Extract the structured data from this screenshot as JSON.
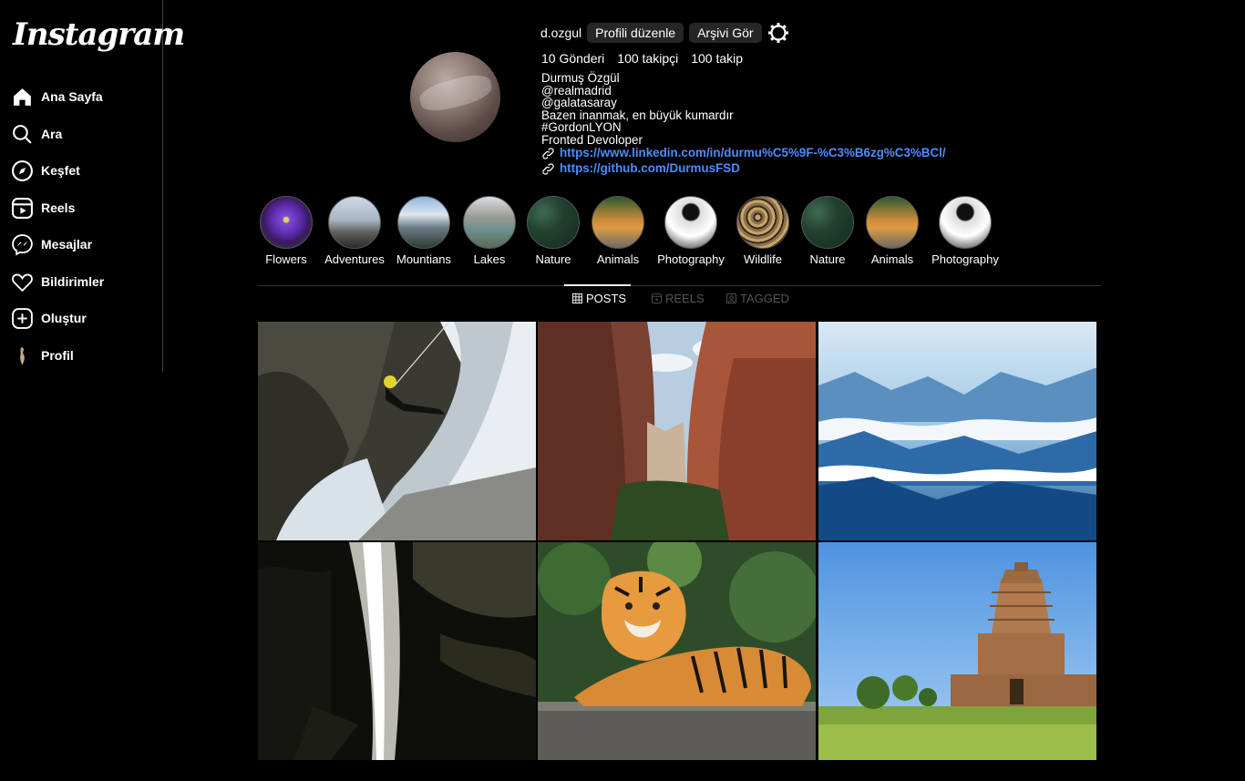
{
  "brand": {
    "logo": "Instagram"
  },
  "sidebar": {
    "items": [
      {
        "label": "Ana Sayfa",
        "icon": "home-icon"
      },
      {
        "label": "Ara",
        "icon": "search-icon"
      },
      {
        "label": "Keşfet",
        "icon": "compass-icon"
      },
      {
        "label": "Reels",
        "icon": "reels-icon"
      },
      {
        "label": "Mesajlar",
        "icon": "messenger-icon"
      },
      {
        "label": "Bildirimler",
        "icon": "heart-icon"
      },
      {
        "label": "Oluştur",
        "icon": "plus-square-icon"
      },
      {
        "label": "Profil",
        "icon": "profile-avatar-icon"
      }
    ]
  },
  "profile": {
    "username": "d.ozgul",
    "edit_button": "Profili düzenle",
    "archive_button": "Arşivi Gör",
    "posts_count": "10 Gönderi",
    "followers": "100 takipçi",
    "following": "100 takip",
    "bio": {
      "name": "Durmuş Özgül",
      "lines": [
        "@realmadrid",
        "@galatasaray",
        "Bazen inanmak, en büyük kumardır",
        "#GordonLYON",
        "Fronted Devoloper"
      ],
      "links": [
        "https://www.linkedin.com/in/durmu%C5%9F-%C3%B6zg%C3%BCl/",
        "https://github.com/DurmusFSD"
      ]
    }
  },
  "highlights": [
    {
      "label": "Flowers"
    },
    {
      "label": "Adventures"
    },
    {
      "label": "Mountians"
    },
    {
      "label": "Lakes"
    },
    {
      "label": "Nature"
    },
    {
      "label": "Animals"
    },
    {
      "label": "Photography"
    },
    {
      "label": "Wildlife"
    },
    {
      "label": "Nature"
    },
    {
      "label": "Animals"
    },
    {
      "label": "Photography"
    }
  ],
  "tabs": [
    {
      "label": "POSTS",
      "icon": "grid-icon",
      "active": true
    },
    {
      "label": "REELS",
      "icon": "reels-icon",
      "active": false
    },
    {
      "label": "TAGGED",
      "icon": "tagged-icon",
      "active": false
    }
  ],
  "posts": [
    {
      "subject": "waterfall-rappel"
    },
    {
      "subject": "canyon"
    },
    {
      "subject": "clouds-mountains"
    },
    {
      "subject": "dark-waterfall"
    },
    {
      "subject": "tiger"
    },
    {
      "subject": "temple"
    }
  ]
}
